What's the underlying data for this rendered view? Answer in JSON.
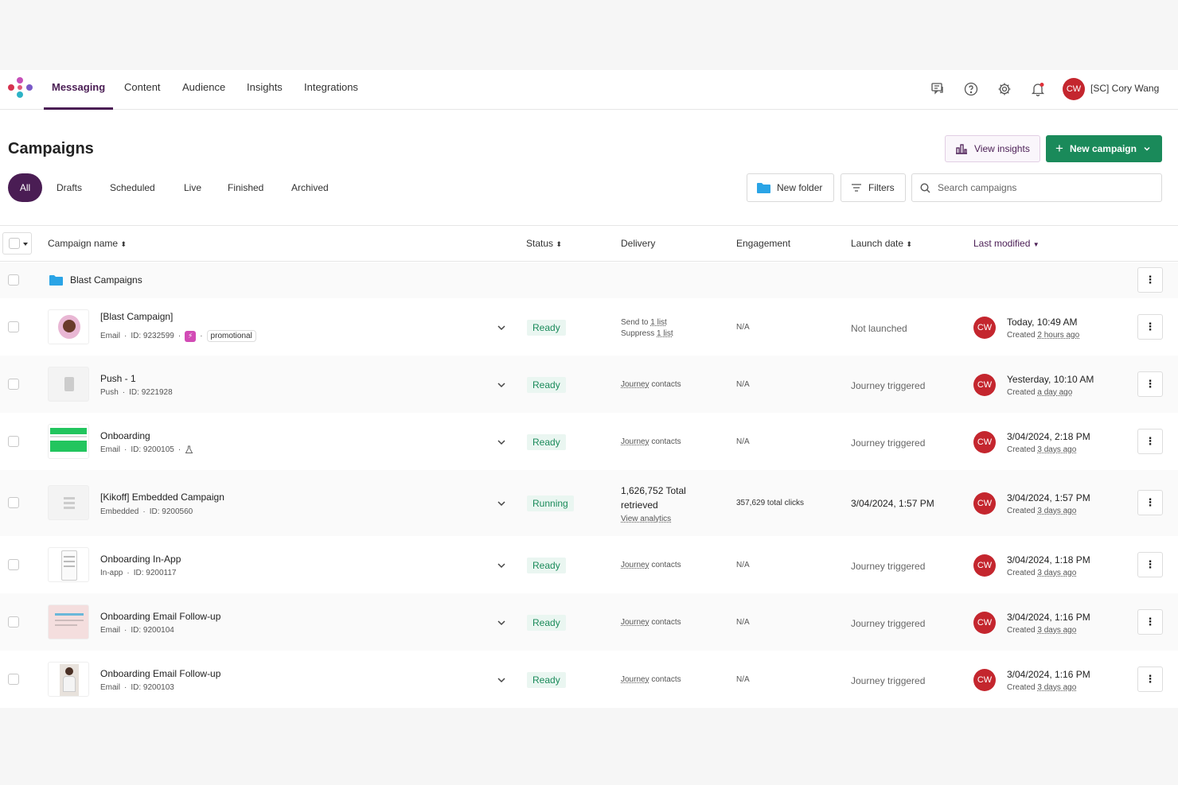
{
  "nav": {
    "tabs": [
      "Messaging",
      "Content",
      "Audience",
      "Insights",
      "Integrations"
    ],
    "user_initials": "CW",
    "user_name": "[SC] Cory Wang",
    "icons": [
      "feedback-icon",
      "help-icon",
      "settings-icon",
      "notification-icon"
    ]
  },
  "page": {
    "title": "Campaigns",
    "view_insights": "View insights",
    "new_campaign": "New campaign",
    "filters": [
      "All",
      "Drafts",
      "Scheduled",
      "Live",
      "Finished",
      "Archived"
    ],
    "new_folder": "New folder",
    "filters_btn": "Filters",
    "search_placeholder": "Search campaigns"
  },
  "table": {
    "headers": {
      "name": "Campaign name",
      "status": "Status",
      "delivery": "Delivery",
      "engagement": "Engagement",
      "launch": "Launch date",
      "modified": "Last modified"
    },
    "folder": "Blast Campaigns",
    "rows": [
      {
        "name": "[Blast Campaign]",
        "type": "Email",
        "id": "ID: 9232599",
        "tag": "promotional",
        "status": "Ready",
        "delivery_line1_prefix": "Send to",
        "delivery_line1_link": "1 list",
        "delivery_line2_prefix": "Suppress",
        "delivery_line2_link": "1 list",
        "engagement": "N/A",
        "launch": "Not launched",
        "initials": "CW",
        "modified": "Today, 10:49 AM",
        "created_prefix": "Created",
        "created": "2 hours ago"
      },
      {
        "name": "Push - 1",
        "type": "Push",
        "id": "ID: 9221928",
        "status": "Ready",
        "delivery_link": "Journey",
        "delivery_suffix": "contacts",
        "engagement": "N/A",
        "launch": "Journey triggered",
        "initials": "CW",
        "modified": "Yesterday, 10:10 AM",
        "created_prefix": "Created",
        "created": "a day ago"
      },
      {
        "name": "Onboarding",
        "type": "Email",
        "id": "ID: 9200105",
        "status": "Ready",
        "delivery_link": "Journey",
        "delivery_suffix": "contacts",
        "engagement": "N/A",
        "launch": "Journey triggered",
        "initials": "CW",
        "modified": "3/04/2024, 2:18 PM",
        "created_prefix": "Created",
        "created": "3 days ago"
      },
      {
        "name": "[Kikoff] Embedded Campaign",
        "type": "Embedded",
        "id": "ID: 9200560",
        "status": "Running",
        "delivery_line1": "1,626,752 Total",
        "delivery_line2": "retrieved",
        "delivery_link": "View analytics",
        "engagement": "357,629 total clicks",
        "launch": "3/04/2024, 1:57 PM",
        "initials": "CW",
        "modified": "3/04/2024, 1:57 PM",
        "created_prefix": "Created",
        "created": "3 days ago"
      },
      {
        "name": "Onboarding In-App",
        "type": "In-app",
        "id": "ID: 9200117",
        "status": "Ready",
        "delivery_link": "Journey",
        "delivery_suffix": "contacts",
        "engagement": "N/A",
        "launch": "Journey triggered",
        "initials": "CW",
        "modified": "3/04/2024, 1:18 PM",
        "created_prefix": "Created",
        "created": "3 days ago"
      },
      {
        "name": "Onboarding Email Follow-up",
        "type": "Email",
        "id": "ID: 9200104",
        "status": "Ready",
        "delivery_link": "Journey",
        "delivery_suffix": "contacts",
        "engagement": "N/A",
        "launch": "Journey triggered",
        "initials": "CW",
        "modified": "3/04/2024, 1:16 PM",
        "created_prefix": "Created",
        "created": "3 days ago"
      },
      {
        "name": "Onboarding Email Follow-up",
        "type": "Email",
        "id": "ID: 9200103",
        "status": "Ready",
        "delivery_link": "Journey",
        "delivery_suffix": "contacts",
        "engagement": "N/A",
        "launch": "Journey triggered",
        "initials": "CW",
        "modified": "3/04/2024, 1:16 PM",
        "created_prefix": "Created",
        "created": "3 days ago"
      }
    ]
  },
  "colors": {
    "brand_purple": "#4a1d54",
    "primary_green": "#1a8a5a",
    "avatar_red": "#c4262e",
    "folder_blue": "#2aa4e6"
  }
}
